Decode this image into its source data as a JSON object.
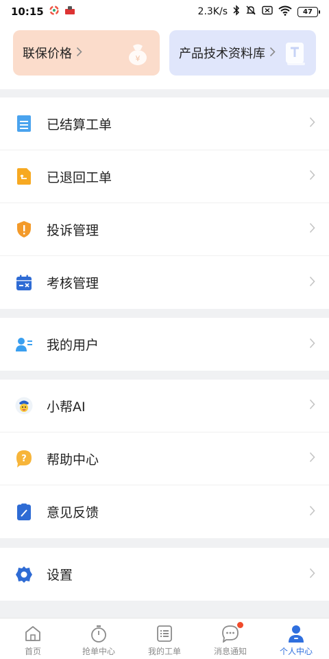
{
  "status_bar": {
    "time": "10:15",
    "network_speed": "2.3K/s",
    "battery": "47"
  },
  "cards": {
    "left": {
      "label": "联保价格"
    },
    "right": {
      "label": "产品技术资料库"
    }
  },
  "groups": [
    {
      "items": [
        {
          "label": "已结算工单",
          "icon": "document-icon"
        },
        {
          "label": "已退回工单",
          "icon": "return-icon"
        },
        {
          "label": "投诉管理",
          "icon": "shield-alert-icon"
        },
        {
          "label": "考核管理",
          "icon": "calendar-icon"
        }
      ]
    },
    {
      "items": [
        {
          "label": "我的用户",
          "icon": "user-card-icon"
        }
      ]
    },
    {
      "items": [
        {
          "label": "小帮AI",
          "icon": "robot-avatar-icon"
        },
        {
          "label": "帮助中心",
          "icon": "help-bubble-icon"
        },
        {
          "label": "意见反馈",
          "icon": "feedback-icon"
        }
      ]
    },
    {
      "items": [
        {
          "label": "设置",
          "icon": "gear-icon"
        }
      ]
    }
  ],
  "tabbar": {
    "items": [
      {
        "label": "首页",
        "icon": "home-icon"
      },
      {
        "label": "抢单中心",
        "icon": "stopwatch-icon"
      },
      {
        "label": "我的工单",
        "icon": "list-icon"
      },
      {
        "label": "消息通知",
        "icon": "chat-icon"
      },
      {
        "label": "个人中心",
        "icon": "person-icon",
        "active": true
      }
    ]
  },
  "colors": {
    "accent": "#2f6fde",
    "card_left_bg": "#fbdccb",
    "card_right_bg": "#e0e6fb",
    "badge": "#f04a2b",
    "page_bg": "#f0f1f3"
  }
}
